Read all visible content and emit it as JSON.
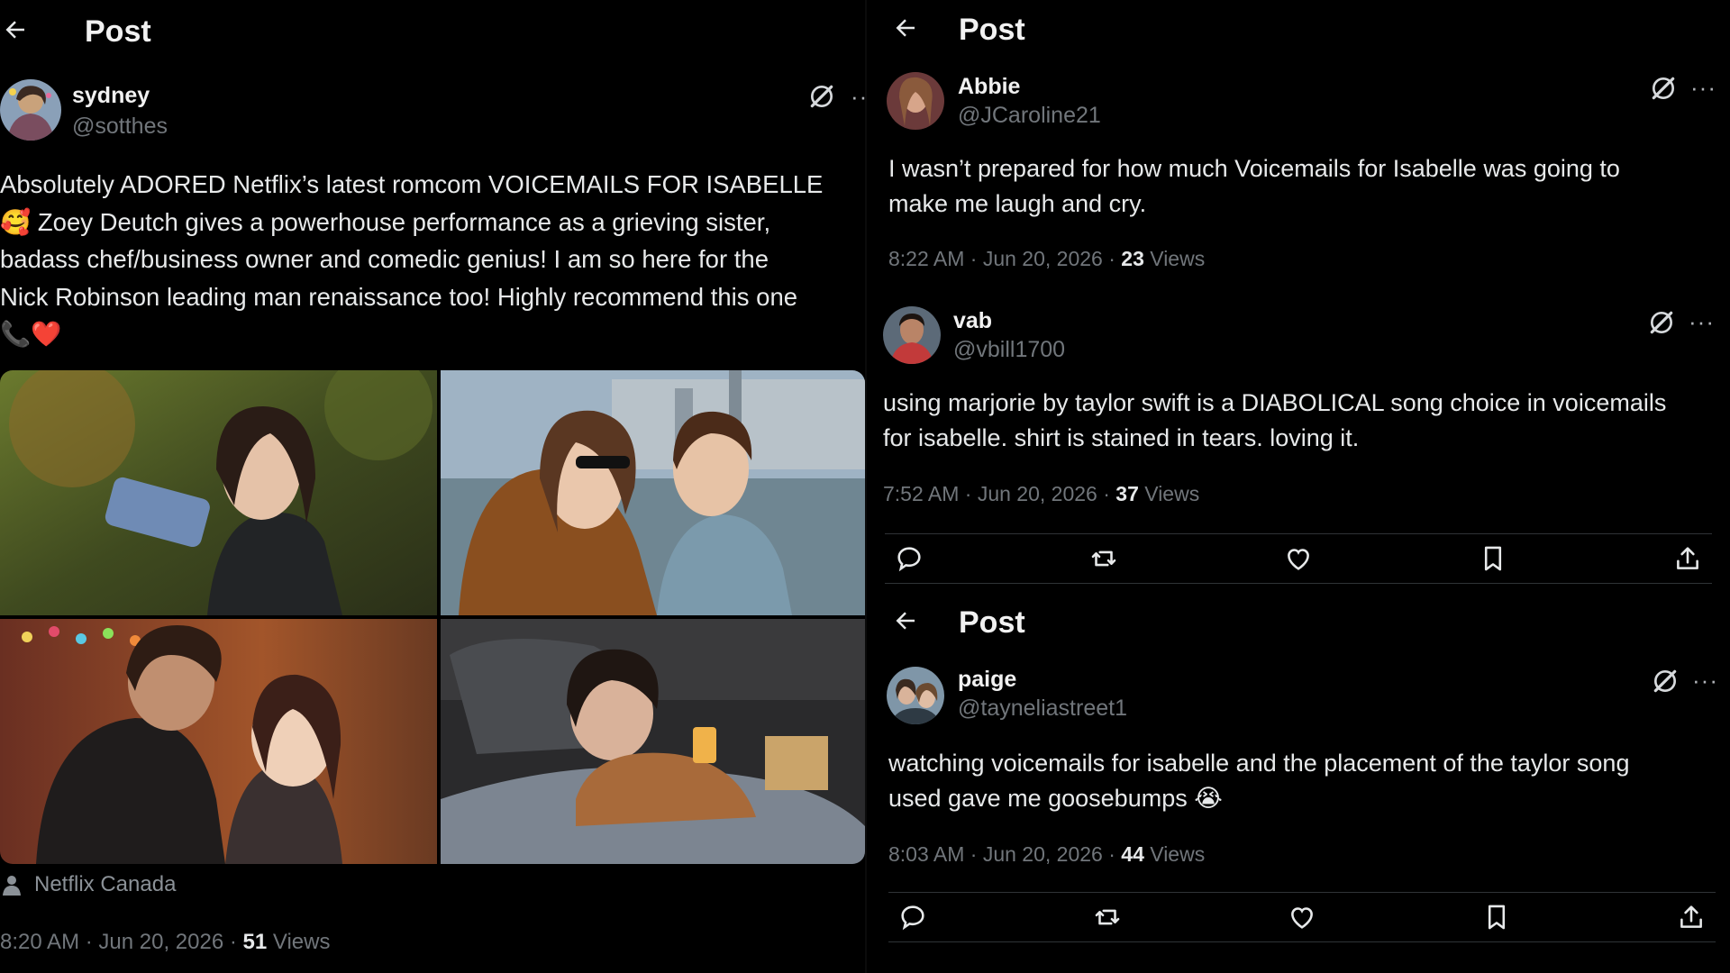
{
  "left_post": {
    "header_title": "Post",
    "author": {
      "name": "sydney",
      "handle": "@sotthes"
    },
    "text_lines": [
      "Absolutely ADORED Netflix’s latest romcom VOICEMAILS FOR ISABELLE",
      "🥰 Zoey Deutch gives a powerhouse performance as a grieving sister,",
      "badass chef/business owner and comedic genius! I am so here for the",
      "Nick Robinson leading man renaissance too! Highly recommend this one",
      "📞❤️"
    ],
    "media_source": "Netflix Canada",
    "time": "8:20 AM · Jun 20, 2026 · ",
    "views_count": "51",
    "views_label": " Views"
  },
  "replies": [
    {
      "author": {
        "name": "Abbie",
        "handle": "@JCaroline21"
      },
      "text_lines": [
        "I wasn’t prepared for how much Voicemails for Isabelle was going to",
        "make me laugh and cry."
      ],
      "time": "8:22 AM · Jun 20, 2026 · ",
      "views_count": "23",
      "views_label": " Views"
    },
    {
      "author": {
        "name": "vab",
        "handle": "@vbill1700"
      },
      "text_lines": [
        "using marjorie by taylor swift is a DIABOLICAL song choice in voicemails",
        "for isabelle. shirt is stained in tears. loving it."
      ],
      "time": "7:52 AM · Jun 20, 2026 · ",
      "views_count": "37",
      "views_label": " Views"
    }
  ],
  "bottom_post": {
    "header_title": "Post",
    "author": {
      "name": "paige",
      "handle": "@tayneliastreet1"
    },
    "text_lines": [
      "watching voicemails for isabelle and the placement of the taylor song",
      "used gave me goosebumps 😭"
    ],
    "time": "8:03 AM · Jun 20, 2026 · ",
    "views_count": "44",
    "views_label": " Views"
  },
  "right_header_title": "Post",
  "more_glyph": "···",
  "icons": {
    "back": "arrow-left-icon",
    "grok": "grok-icon",
    "more": "more-icon",
    "reply": "reply-icon",
    "repost": "repost-icon",
    "like": "heart-icon",
    "bookmark": "bookmark-icon",
    "share": "share-icon",
    "source": "person-icon"
  },
  "colors": {
    "background": "#000000",
    "text": "#e7e9ea",
    "muted": "#71767b",
    "divider": "#2f3336"
  }
}
